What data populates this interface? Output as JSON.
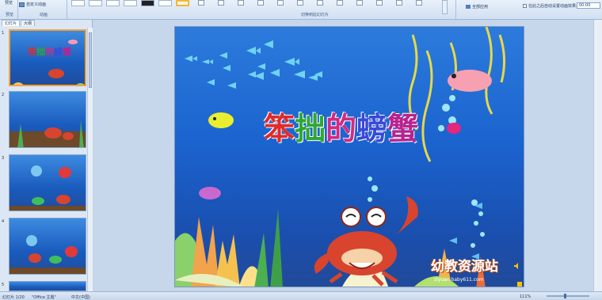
{
  "ribbon": {
    "preview_label": "预览",
    "custom_animation_label": "自定义动画",
    "group_preview": "预览",
    "group_animation": "动画",
    "group_transition": "切换到此幻灯片",
    "apply_all": "全部应用",
    "auto_after_label": "在此之后自动设置动画效果:",
    "auto_after_value": "00:00"
  },
  "left_panel": {
    "tabs": [
      "幻灯片",
      "大纲"
    ],
    "slides": [
      {
        "num": "1"
      },
      {
        "num": "2"
      },
      {
        "num": "3"
      },
      {
        "num": "4"
      },
      {
        "num": "5"
      }
    ]
  },
  "slide": {
    "title_chars": [
      "笨",
      "拙",
      "的",
      "螃",
      "蟹"
    ],
    "logo_text": "幼教资源站",
    "logo_url": "ziyuan.baby611.com"
  },
  "status": {
    "slide_counter": "幻灯片 1/20",
    "theme": "\"Office 主题\"",
    "language": "中文(中国)",
    "zoom": "111%"
  },
  "colors": {
    "ocean_top": "#2c7bdc",
    "ocean_bottom": "#214a9a",
    "ribbon_bg": "#d2e0f2",
    "selection": "#f2a33a"
  }
}
